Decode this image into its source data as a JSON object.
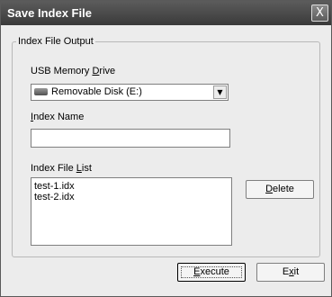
{
  "window": {
    "title": "Save Index File",
    "close_glyph": "X"
  },
  "group": {
    "legend": "Index File Output"
  },
  "usb_drive": {
    "label_pre": "USB Memory ",
    "label_mnemonic": "D",
    "label_post": "rive",
    "selected": "Removable Disk (E:)",
    "icon": "removable-disk-icon",
    "arrow_glyph": "▼"
  },
  "index_name": {
    "label_mnemonic": "I",
    "label_post": "ndex Name",
    "value": ""
  },
  "index_file_list": {
    "label_pre": "Index File ",
    "label_mnemonic": "L",
    "label_post": "ist",
    "items": [
      "test-1.idx",
      "test-2.idx"
    ]
  },
  "buttons": {
    "delete": {
      "mnemonic": "D",
      "post": "elete"
    },
    "execute": {
      "mnemonic": "E",
      "post": "xecute"
    },
    "exit": {
      "pre": "E",
      "mnemonic": "x",
      "post": "it"
    }
  }
}
